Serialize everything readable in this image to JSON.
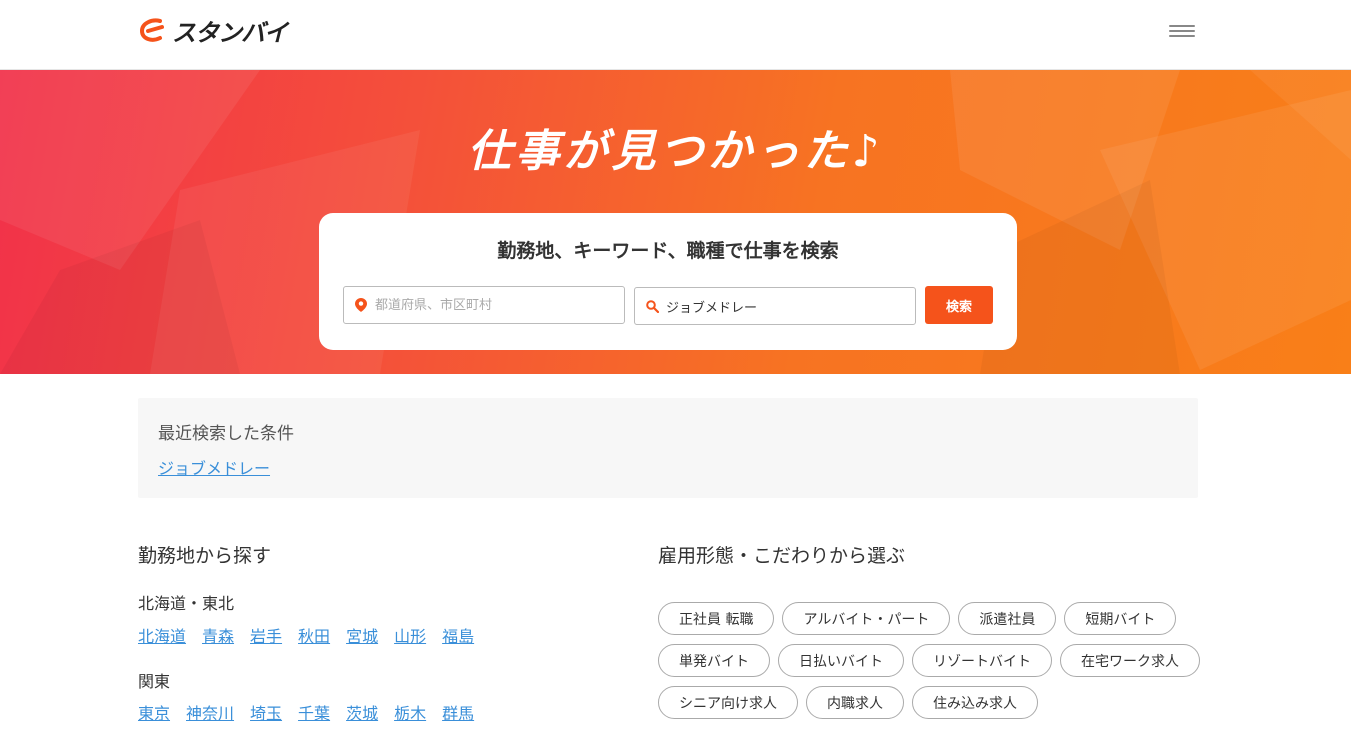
{
  "header": {
    "logo_text": "スタンバイ",
    "menu_icon": "hamburger-menu-icon"
  },
  "hero": {
    "title": "仕事が見つかった♪",
    "search": {
      "heading": "勤務地、キーワード、職種で仕事を検索",
      "location_placeholder": "都道府県、市区町村",
      "location_value": "",
      "keyword_value": "ジョブメドレー",
      "button_label": "検索"
    }
  },
  "recent": {
    "title": "最近検索した条件",
    "items": [
      "ジョブメドレー"
    ]
  },
  "location_section": {
    "title": "勤務地から探す",
    "regions": [
      {
        "name": "北海道・東北",
        "prefectures": [
          "北海道",
          "青森",
          "岩手",
          "秋田",
          "宮城",
          "山形",
          "福島"
        ]
      },
      {
        "name": "関東",
        "prefectures": [
          "東京",
          "神奈川",
          "埼玉",
          "千葉",
          "茨城",
          "栃木",
          "群馬"
        ]
      }
    ]
  },
  "employment_section": {
    "title": "雇用形態・こだわりから選ぶ",
    "chips": [
      "正社員 転職",
      "アルバイト・パート",
      "派遣社員",
      "短期バイト",
      "単発バイト",
      "日払いバイト",
      "リゾートバイト",
      "在宅ワーク求人",
      "シニア向け求人",
      "内職求人",
      "住み込み求人"
    ]
  },
  "colors": {
    "accent": "#f5531b",
    "link": "#3a8fd9",
    "hero_start": "#f2314a",
    "hero_end": "#f97f18"
  }
}
